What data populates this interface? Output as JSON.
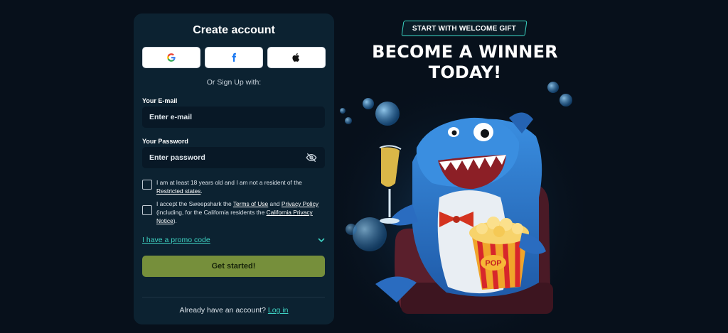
{
  "form": {
    "title": "Create account",
    "social": [
      {
        "name": "google-icon"
      },
      {
        "name": "facebook-icon"
      },
      {
        "name": "apple-icon"
      }
    ],
    "or_text": "Or Sign Up with:",
    "email": {
      "label": "Your E-mail",
      "placeholder": "Enter e-mail",
      "value": ""
    },
    "password": {
      "label": "Your Password",
      "placeholder": "Enter password",
      "value": "",
      "toggle_icon": "eye-slash-icon"
    },
    "age_check": {
      "text": "I am at least 18 years old and I am not a resident of the",
      "link": "Restricted states",
      "suffix": ".",
      "checked": false
    },
    "terms_check": {
      "text1": "I accept the Sweepshark the",
      "link1": "Terms of Use",
      "text2": "and",
      "link2": "Privacy Policy",
      "text3": "(including, for the California residents the",
      "link3": "California Privacy Notice",
      "suffix": ").",
      "checked": false
    },
    "promo_link": "I have a promo code",
    "promo_icon": "chevron-down-icon",
    "submit_label": "Get started!",
    "login_prompt": "Already have an account?",
    "login_link": "Log in"
  },
  "promo": {
    "badge": "START WITH WELCOME GIFT",
    "headline_line1": "BECOME A WINNER",
    "headline_line2": "TODAY!",
    "popcorn_label": "POP"
  },
  "colors": {
    "background": "#07101b",
    "card": "#0c2231",
    "accent": "#3ed1c2",
    "cta": "#768f3b"
  }
}
